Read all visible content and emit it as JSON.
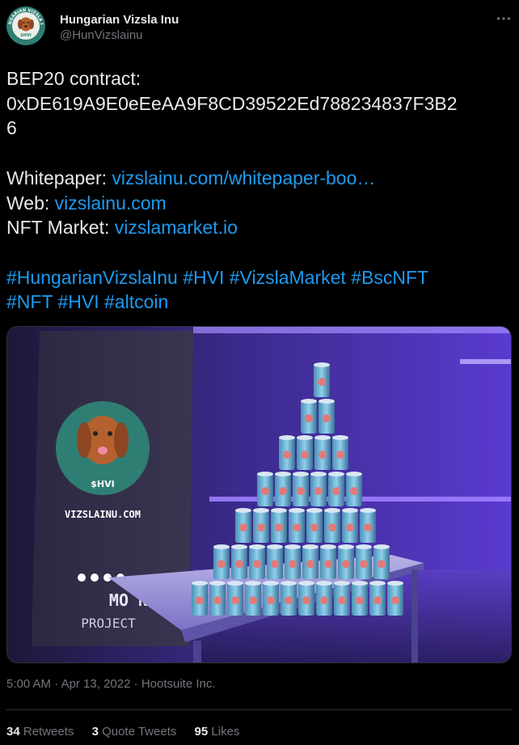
{
  "author": {
    "display_name": "Hungarian Vizsla Inu",
    "handle": "@HunVizslainu",
    "avatar_ring_text": "HUNGARIAN VIZSLA INU",
    "avatar_label": "$HVI"
  },
  "tweet": {
    "contract_label": "BEP20 contract:",
    "contract_address_line1": "0xDE619A9E0eEeAA9F8CD39522Ed788234837F3B2",
    "contract_address_line2": "6",
    "whitepaper_label": "Whitepaper:",
    "whitepaper_link": "vizslainu.com/whitepaper-boo…",
    "web_label": "Web:",
    "web_link": "vizslainu.com",
    "nft_label": "NFT Market:",
    "nft_link": "vizslamarket.io",
    "hashtags_line1": [
      "#HungarianVizslaInu",
      "#HVI",
      "#VizslaMarket",
      "#BscNFT"
    ],
    "hashtags_line2": [
      "#NFT",
      "#HVI",
      "#altcoin"
    ]
  },
  "media": {
    "banner_token": "$HVI",
    "banner_site": "VIZSLAINU.COM",
    "banner_moon_top": "MO  N",
    "banner_moon_bottom": "PROJECT"
  },
  "meta": {
    "time": "5:00 AM",
    "date": "Apr 13, 2022",
    "source": "Hootsuite Inc.",
    "separator": "·"
  },
  "stats": {
    "retweets_count": "34",
    "retweets_label": "Retweets",
    "quotes_count": "3",
    "quotes_label": "Quote Tweets",
    "likes_count": "95",
    "likes_label": "Likes"
  },
  "colors": {
    "background": "#000000",
    "text": "#e7e9ea",
    "muted": "#71767b",
    "link": "#1d9bf0",
    "divider": "#2f3336"
  },
  "icons": [
    "more-icon"
  ]
}
